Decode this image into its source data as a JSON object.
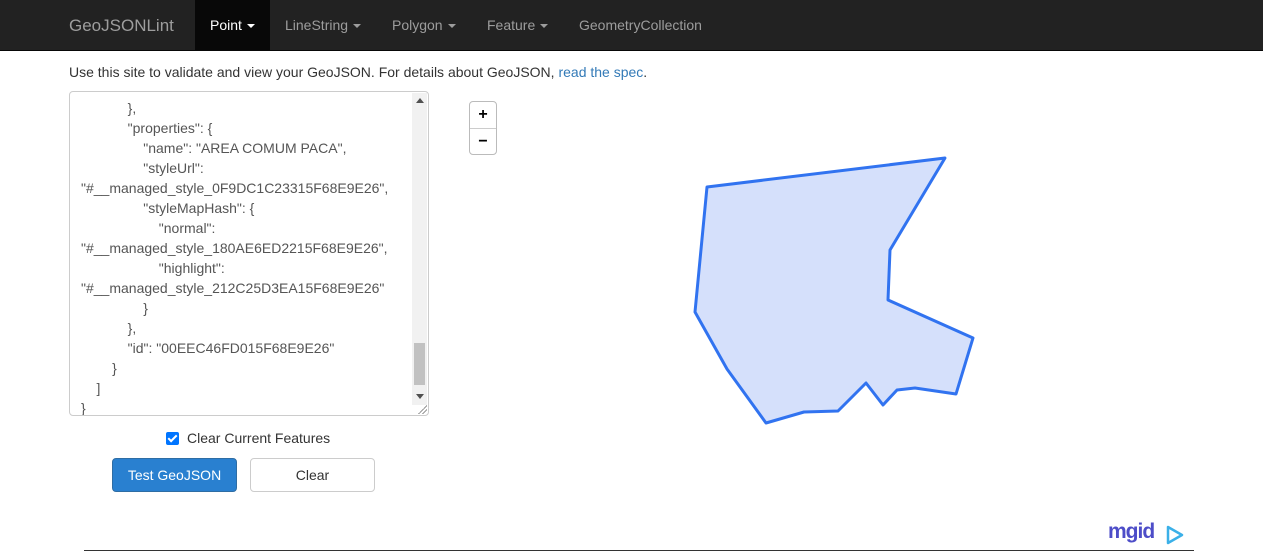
{
  "navbar": {
    "brand": "GeoJSONLint",
    "items": [
      {
        "label": "Point",
        "dropdown": true,
        "active": true
      },
      {
        "label": "LineString",
        "dropdown": true,
        "active": false
      },
      {
        "label": "Polygon",
        "dropdown": true,
        "active": false
      },
      {
        "label": "Feature",
        "dropdown": true,
        "active": false
      },
      {
        "label": "GeometryCollection",
        "dropdown": false,
        "active": false
      }
    ]
  },
  "intro": {
    "text": "Use this site to validate and view your GeoJSON. For details about GeoJSON, ",
    "link_text": "read the spec",
    "suffix": "."
  },
  "editor": {
    "text": "            },\n            \"properties\": {\n                \"name\": \"AREA COMUM PACA\",\n                \"styleUrl\":\n\"#__managed_style_0F9DC1C23315F68E9E26\",\n                \"styleMapHash\": {\n                    \"normal\":\n\"#__managed_style_180AE6ED2215F68E9E26\",\n                    \"highlight\":\n\"#__managed_style_212C25D3EA15F68E9E26\"\n                }\n            },\n            \"id\": \"00EEC46FD015F68E9E26\"\n        }\n    ]\n}"
  },
  "clear_checkbox": {
    "label": "Clear Current Features",
    "checked": true
  },
  "buttons": {
    "test": "Test GeoJSON",
    "clear": "Clear"
  },
  "map": {
    "zoom_in": "+",
    "zoom_out": "−",
    "stroke_color": "#3173f0",
    "fill_color": "#d5e0fb"
  },
  "ad": {
    "brand": "mgid",
    "icon": "play-triangle-icon"
  },
  "colors": {
    "navbar_bg": "#222222",
    "primary": "#2980d0",
    "link": "#337ab7",
    "checkbox": "#0075ff"
  }
}
